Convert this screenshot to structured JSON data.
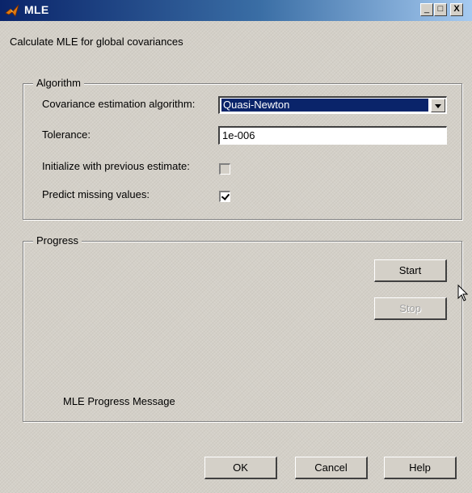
{
  "window": {
    "title": "MLE",
    "minimize_glyph": "_",
    "maximize_glyph": "□",
    "close_glyph": "X"
  },
  "description": "Calculate MLE for global covariances",
  "algorithm": {
    "legend": "Algorithm",
    "cov_label": "Covariance estimation algorithm:",
    "cov_value": "Quasi-Newton",
    "tolerance_label": "Tolerance:",
    "tolerance_value": "1e-006",
    "init_label": "Initialize with previous estimate:",
    "init_checked": false,
    "predict_label": "Predict missing values:",
    "predict_checked": true
  },
  "progress": {
    "legend": "Progress",
    "start_label": "Start",
    "stop_label": "Stop",
    "message": "MLE Progress Message"
  },
  "buttons": {
    "ok": "OK",
    "cancel": "Cancel",
    "help": "Help"
  },
  "colors": {
    "titlebar_start": "#0a246a",
    "titlebar_end": "#a6caf0",
    "face": "#d4d0c8",
    "selection": "#0a246a"
  }
}
